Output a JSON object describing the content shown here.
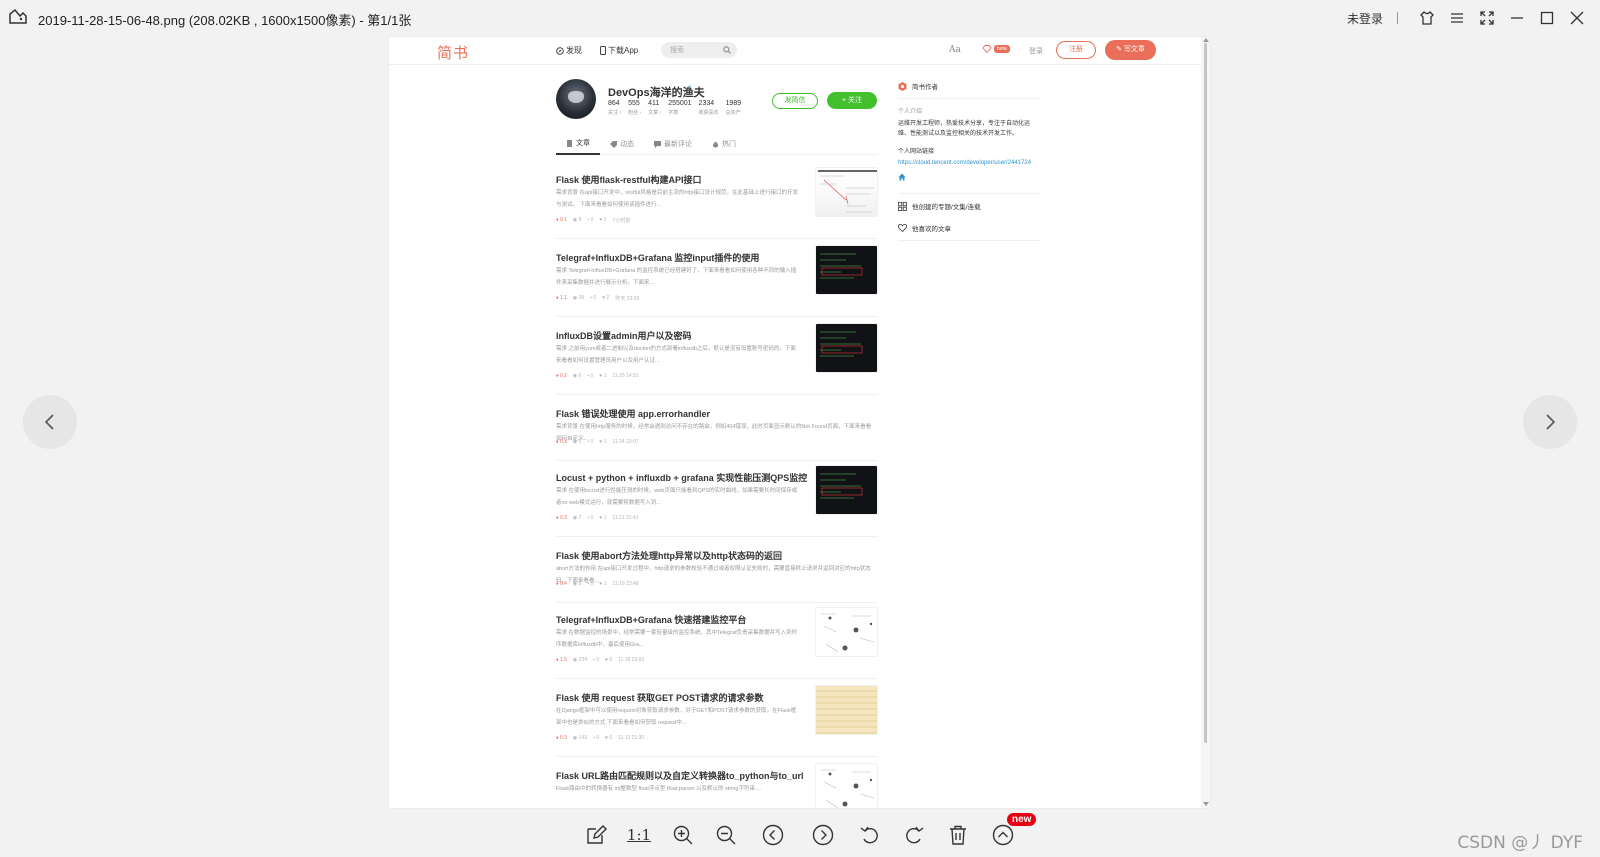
{
  "viewer": {
    "title": "2019-11-28-15-06-48.png (208.02KB , 1600x1500像素) - 第1/1张",
    "login": "未登录",
    "icons": [
      "skin-icon",
      "menu-icon",
      "fullscreen-icon",
      "minimize-icon",
      "maximize-icon",
      "close-icon"
    ]
  },
  "jianshu": {
    "logo": "简书",
    "nav_discover": "发现",
    "nav_app": "下载App",
    "search_placeholder": "搜索",
    "aa": "Aa",
    "beta": "beta",
    "login": "登录",
    "register": "注册",
    "write": "写文章"
  },
  "profile": {
    "name": "DevOps海洋的渔夫",
    "gender": "♂",
    "stats": [
      {
        "n": "864",
        "l": "关注 ›"
      },
      {
        "n": "555",
        "l": "粉丝 ›"
      },
      {
        "n": "411",
        "l": "文章 ›"
      },
      {
        "n": "255001",
        "l": "字数"
      },
      {
        "n": "2334",
        "l": "收获喜欢"
      },
      {
        "n": "1989",
        "l": "总资产"
      }
    ],
    "btn_message": "发简信",
    "btn_follow": "+ 关注"
  },
  "tabs": [
    "文章",
    "动态",
    "最新评论",
    "热门"
  ],
  "articles": [
    {
      "title": "Flask 使用flask-restful构建API接口",
      "abstract": "需求背景 在api接口开发中，restful风格是目前主流的http接口设计规范，在此基础上进行接口的开发与测试。 下面来看看如何使用该插件进行...",
      "gem": "0.1",
      "views": "8",
      "comments": "0",
      "likes": "2",
      "time": "7小时前",
      "thumb": "light"
    },
    {
      "title": "Telegraf+InfluxDB+Grafana 监控input插件的使用",
      "abstract": "需求 Telegraf+InfluxDB+Grafana 的监控系统已经搭建好了，下面来看看如何使用各种不同的输入插件来采集数据并进行展示分析。下面来...",
      "gem": "1.1",
      "views": "26",
      "comments": "0",
      "likes": "2",
      "time": "昨天 23:03",
      "thumb": "dark"
    },
    {
      "title": "InfluxDB设置admin用户以及密码",
      "abstract": "需求 之前用yum或者二进制以及docker的方式部署influxdb之后，默认是没有设置账号密码的，下面来看看如何设置管理员用户以及用户认证...",
      "gem": "0.2",
      "views": "6",
      "comments": "0",
      "likes": "1",
      "time": "11.25 14:31",
      "thumb": "dark"
    },
    {
      "title": "Flask 错误处理使用 app.errorhandler",
      "abstract": "需求背景 在使用http服务的时候，经常会遇到访问不存在的路由，例如404错误，此时页面显示默认的Not Found页面，下面来看看如何自定义...",
      "gem": "0.3",
      "views": "5",
      "comments": "0",
      "likes": "1",
      "time": "11.24 23:07",
      "thumb": ""
    },
    {
      "title": "Locust + python + influxdb + grafana 实现性能压测QPS监控",
      "abstract": "需求 在使用locust进行性能压测的时候，web页面只能看到QPS的实时曲线，如果需要长时间保存或者no web模式运行，就需要将数据写入到...",
      "gem": "0.3",
      "views": "7",
      "comments": "0",
      "likes": "1",
      "time": "11.21 21:41",
      "thumb": "dark"
    },
    {
      "title": "Flask 使用abort方法处理http异常以及http状态码的返回",
      "abstract": "abort方法的作用 在api接口开发过程中，http请求的参数校验不通过或者权限认证失败时，需要直接终止请求并返回对应的http状态码，下面来看看...",
      "gem": "0.4",
      "views": "9",
      "comments": "0",
      "likes": "1",
      "time": "11.19 23:48",
      "thumb": ""
    },
    {
      "title": "Telegraf+InfluxDB+Grafana 快速搭建监控平台",
      "abstract": "需求 在数据监控的场景中，经常需要一套轻量级的监控系统，其中Telegraf负责采集数据并写入到时序数据库influxdb中，最后使用Gra...",
      "gem": "1.5",
      "views": "234",
      "comments": "0",
      "likes": "6",
      "time": "11.18 23:03",
      "thumb": "sketch"
    },
    {
      "title": "Flask 使用 request 获取GET POST请求的请求参数",
      "abstract": "在Django框架中可以使用request对象获取请求参数，对于GET和POST请求参数的获取，在Flask框架中也是类似的方式 下面来看看如何获取 request中...",
      "gem": "0.3",
      "views": "143",
      "comments": "0",
      "likes": "6",
      "time": "11.13 21:30",
      "thumb": "tan"
    },
    {
      "title": "Flask URL路由匹配规则以及自定义转换器to_python与to_url",
      "abstract": "Flask路由中的转换器有 int整数型 float浮点型 float:param 以及默认的 string字符串 ...",
      "gem": "",
      "views": "",
      "comments": "",
      "likes": "",
      "time": "",
      "thumb": "sketch"
    }
  ],
  "sidebar": {
    "badge": "简书作者",
    "intro_label": "个人介绍",
    "intro_text": "运维开发工程师，热爱技术分享，专注于自动化运维、性能测试以及监控相关的技术开发工作。",
    "site_label": "个人网站链接",
    "site_url": "https://cloud.tencent.com/developer/user/2441724",
    "topics": "他创建的专题/文集/连载",
    "liked": "他喜欢的文章"
  },
  "watermark": "CSDN @丿 DYF",
  "toolbar": {
    "ratio": "1:1",
    "new_badge": "new"
  }
}
